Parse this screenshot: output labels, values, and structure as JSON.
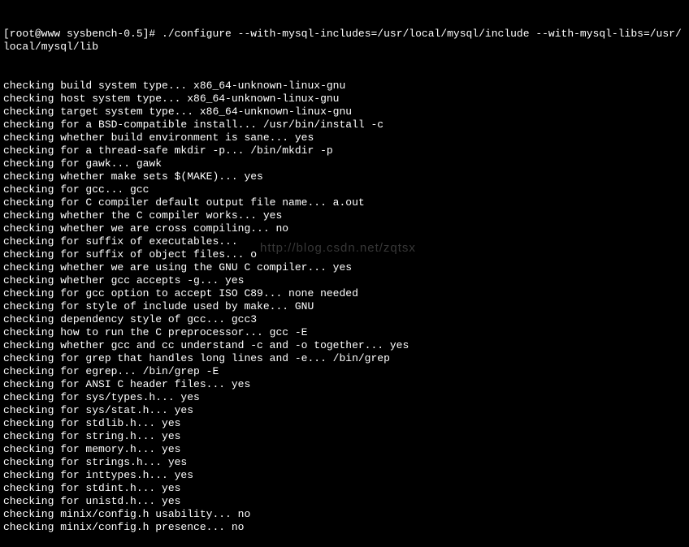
{
  "terminal": {
    "prompt": "[root@www sysbench-0.5]# ",
    "command": "./configure --with-mysql-includes=/usr/local/mysql/include --with-mysql-libs=/usr/local/mysql/lib",
    "lines": [
      "checking build system type... x86_64-unknown-linux-gnu",
      "checking host system type... x86_64-unknown-linux-gnu",
      "checking target system type... x86_64-unknown-linux-gnu",
      "checking for a BSD-compatible install... /usr/bin/install -c",
      "checking whether build environment is sane... yes",
      "checking for a thread-safe mkdir -p... /bin/mkdir -p",
      "checking for gawk... gawk",
      "checking whether make sets $(MAKE)... yes",
      "checking for gcc... gcc",
      "checking for C compiler default output file name... a.out",
      "checking whether the C compiler works... yes",
      "checking whether we are cross compiling... no",
      "checking for suffix of executables... ",
      "checking for suffix of object files... o",
      "checking whether we are using the GNU C compiler... yes",
      "checking whether gcc accepts -g... yes",
      "checking for gcc option to accept ISO C89... none needed",
      "checking for style of include used by make... GNU",
      "checking dependency style of gcc... gcc3",
      "checking how to run the C preprocessor... gcc -E",
      "checking whether gcc and cc understand -c and -o together... yes",
      "checking for grep that handles long lines and -e... /bin/grep",
      "checking for egrep... /bin/grep -E",
      "checking for ANSI C header files... yes",
      "checking for sys/types.h... yes",
      "checking for sys/stat.h... yes",
      "checking for stdlib.h... yes",
      "checking for string.h... yes",
      "checking for memory.h... yes",
      "checking for strings.h... yes",
      "checking for inttypes.h... yes",
      "checking for stdint.h... yes",
      "checking for unistd.h... yes",
      "checking minix/config.h usability... no",
      "checking minix/config.h presence... no"
    ]
  },
  "watermark": "http://blog.csdn.net/zqtsx"
}
